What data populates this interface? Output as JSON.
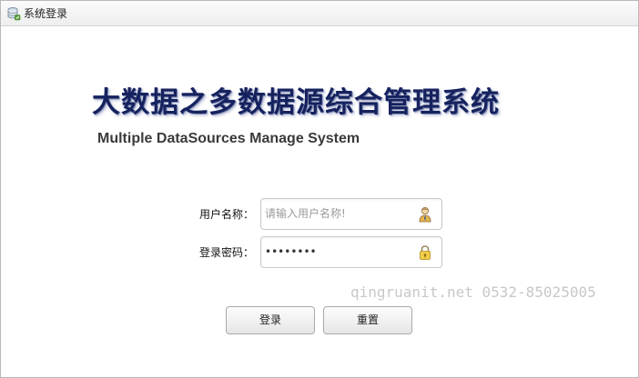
{
  "window": {
    "title": "系统登录"
  },
  "header": {
    "app_title": "大数据之多数据源综合管理系统",
    "app_subtitle": "Multiple DataSources Manage System"
  },
  "form": {
    "username": {
      "label": "用户名称：",
      "placeholder": "请输入用户名称!",
      "value": "",
      "icon": "user-icon"
    },
    "password": {
      "label": "登录密码：",
      "value": "••••••••",
      "icon": "lock-icon"
    }
  },
  "buttons": {
    "login_label": "登录",
    "reset_label": "重置"
  },
  "watermark": "qingruanit.net 0532-85025005",
  "colors": {
    "title": "#15225e",
    "subtitle": "#3a3a3a",
    "border": "#c9c9c9",
    "watermark": "#c8c8c8"
  }
}
